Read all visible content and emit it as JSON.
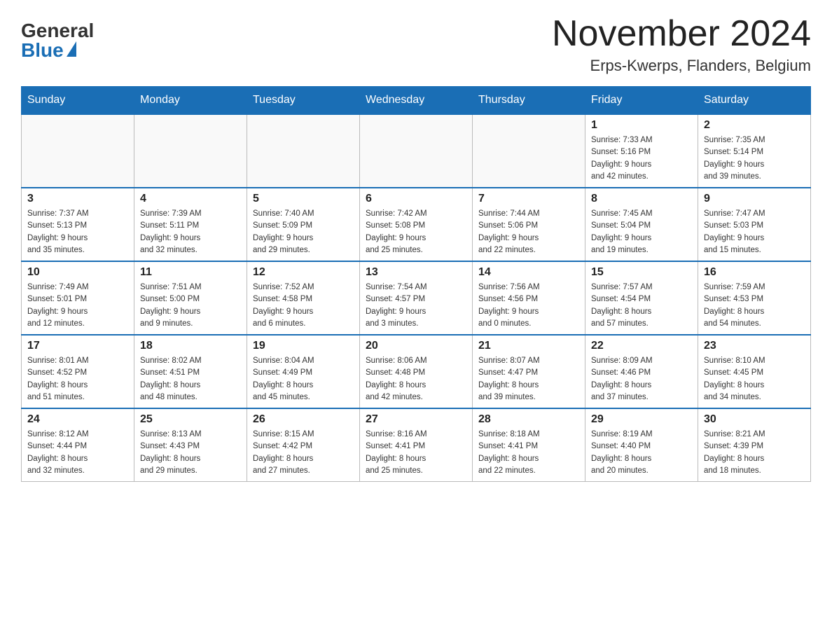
{
  "logo": {
    "general": "General",
    "blue": "Blue"
  },
  "title": "November 2024",
  "location": "Erps-Kwerps, Flanders, Belgium",
  "weekdays": [
    "Sunday",
    "Monday",
    "Tuesday",
    "Wednesday",
    "Thursday",
    "Friday",
    "Saturday"
  ],
  "weeks": [
    [
      {
        "day": "",
        "info": ""
      },
      {
        "day": "",
        "info": ""
      },
      {
        "day": "",
        "info": ""
      },
      {
        "day": "",
        "info": ""
      },
      {
        "day": "",
        "info": ""
      },
      {
        "day": "1",
        "info": "Sunrise: 7:33 AM\nSunset: 5:16 PM\nDaylight: 9 hours\nand 42 minutes."
      },
      {
        "day": "2",
        "info": "Sunrise: 7:35 AM\nSunset: 5:14 PM\nDaylight: 9 hours\nand 39 minutes."
      }
    ],
    [
      {
        "day": "3",
        "info": "Sunrise: 7:37 AM\nSunset: 5:13 PM\nDaylight: 9 hours\nand 35 minutes."
      },
      {
        "day": "4",
        "info": "Sunrise: 7:39 AM\nSunset: 5:11 PM\nDaylight: 9 hours\nand 32 minutes."
      },
      {
        "day": "5",
        "info": "Sunrise: 7:40 AM\nSunset: 5:09 PM\nDaylight: 9 hours\nand 29 minutes."
      },
      {
        "day": "6",
        "info": "Sunrise: 7:42 AM\nSunset: 5:08 PM\nDaylight: 9 hours\nand 25 minutes."
      },
      {
        "day": "7",
        "info": "Sunrise: 7:44 AM\nSunset: 5:06 PM\nDaylight: 9 hours\nand 22 minutes."
      },
      {
        "day": "8",
        "info": "Sunrise: 7:45 AM\nSunset: 5:04 PM\nDaylight: 9 hours\nand 19 minutes."
      },
      {
        "day": "9",
        "info": "Sunrise: 7:47 AM\nSunset: 5:03 PM\nDaylight: 9 hours\nand 15 minutes."
      }
    ],
    [
      {
        "day": "10",
        "info": "Sunrise: 7:49 AM\nSunset: 5:01 PM\nDaylight: 9 hours\nand 12 minutes."
      },
      {
        "day": "11",
        "info": "Sunrise: 7:51 AM\nSunset: 5:00 PM\nDaylight: 9 hours\nand 9 minutes."
      },
      {
        "day": "12",
        "info": "Sunrise: 7:52 AM\nSunset: 4:58 PM\nDaylight: 9 hours\nand 6 minutes."
      },
      {
        "day": "13",
        "info": "Sunrise: 7:54 AM\nSunset: 4:57 PM\nDaylight: 9 hours\nand 3 minutes."
      },
      {
        "day": "14",
        "info": "Sunrise: 7:56 AM\nSunset: 4:56 PM\nDaylight: 9 hours\nand 0 minutes."
      },
      {
        "day": "15",
        "info": "Sunrise: 7:57 AM\nSunset: 4:54 PM\nDaylight: 8 hours\nand 57 minutes."
      },
      {
        "day": "16",
        "info": "Sunrise: 7:59 AM\nSunset: 4:53 PM\nDaylight: 8 hours\nand 54 minutes."
      }
    ],
    [
      {
        "day": "17",
        "info": "Sunrise: 8:01 AM\nSunset: 4:52 PM\nDaylight: 8 hours\nand 51 minutes."
      },
      {
        "day": "18",
        "info": "Sunrise: 8:02 AM\nSunset: 4:51 PM\nDaylight: 8 hours\nand 48 minutes."
      },
      {
        "day": "19",
        "info": "Sunrise: 8:04 AM\nSunset: 4:49 PM\nDaylight: 8 hours\nand 45 minutes."
      },
      {
        "day": "20",
        "info": "Sunrise: 8:06 AM\nSunset: 4:48 PM\nDaylight: 8 hours\nand 42 minutes."
      },
      {
        "day": "21",
        "info": "Sunrise: 8:07 AM\nSunset: 4:47 PM\nDaylight: 8 hours\nand 39 minutes."
      },
      {
        "day": "22",
        "info": "Sunrise: 8:09 AM\nSunset: 4:46 PM\nDaylight: 8 hours\nand 37 minutes."
      },
      {
        "day": "23",
        "info": "Sunrise: 8:10 AM\nSunset: 4:45 PM\nDaylight: 8 hours\nand 34 minutes."
      }
    ],
    [
      {
        "day": "24",
        "info": "Sunrise: 8:12 AM\nSunset: 4:44 PM\nDaylight: 8 hours\nand 32 minutes."
      },
      {
        "day": "25",
        "info": "Sunrise: 8:13 AM\nSunset: 4:43 PM\nDaylight: 8 hours\nand 29 minutes."
      },
      {
        "day": "26",
        "info": "Sunrise: 8:15 AM\nSunset: 4:42 PM\nDaylight: 8 hours\nand 27 minutes."
      },
      {
        "day": "27",
        "info": "Sunrise: 8:16 AM\nSunset: 4:41 PM\nDaylight: 8 hours\nand 25 minutes."
      },
      {
        "day": "28",
        "info": "Sunrise: 8:18 AM\nSunset: 4:41 PM\nDaylight: 8 hours\nand 22 minutes."
      },
      {
        "day": "29",
        "info": "Sunrise: 8:19 AM\nSunset: 4:40 PM\nDaylight: 8 hours\nand 20 minutes."
      },
      {
        "day": "30",
        "info": "Sunrise: 8:21 AM\nSunset: 4:39 PM\nDaylight: 8 hours\nand 18 minutes."
      }
    ]
  ]
}
